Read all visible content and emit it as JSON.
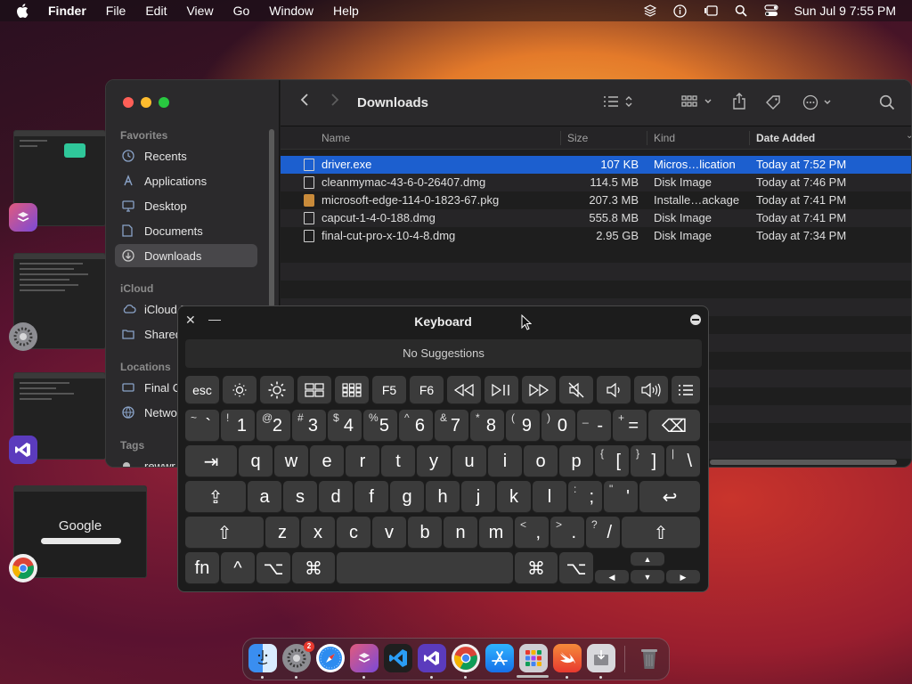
{
  "menubar": {
    "app": "Finder",
    "items": [
      "File",
      "Edit",
      "View",
      "Go",
      "Window",
      "Help"
    ],
    "clock": "Sun Jul 9  7:55 PM"
  },
  "finder": {
    "folder_title": "Downloads",
    "sidebar": {
      "favorites_header": "Favorites",
      "favorites": [
        {
          "label": "Recents",
          "icon": "clock-icon"
        },
        {
          "label": "Applications",
          "icon": "applications-icon"
        },
        {
          "label": "Desktop",
          "icon": "desktop-icon"
        },
        {
          "label": "Documents",
          "icon": "document-icon"
        },
        {
          "label": "Downloads",
          "icon": "download-icon"
        }
      ],
      "icloud_header": "iCloud",
      "icloud": [
        {
          "label": "iCloud D",
          "icon": "cloud-icon"
        },
        {
          "label": "Shared",
          "icon": "shared-folder-icon"
        }
      ],
      "locations_header": "Locations",
      "locations": [
        {
          "label": "Final C",
          "icon": "disk-icon"
        },
        {
          "label": "Netwo",
          "icon": "network-icon"
        }
      ],
      "tags_header": "Tags",
      "tags": [
        {
          "label": "rewwr",
          "icon": "tag-dot-icon"
        }
      ]
    },
    "columns": {
      "name": "Name",
      "size": "Size",
      "kind": "Kind",
      "date": "Date Added"
    },
    "files": [
      {
        "name": "driver.exe",
        "size": "107 KB",
        "kind": "Micros…lication",
        "date": "Today at 7:52 PM",
        "type": "doc"
      },
      {
        "name": "cleanmymac-43-6-0-26407.dmg",
        "size": "114.5 MB",
        "kind": "Disk Image",
        "date": "Today at 7:46 PM",
        "type": "doc"
      },
      {
        "name": "microsoft-edge-114-0-1823-67.pkg",
        "size": "207.3 MB",
        "kind": "Installe…ackage",
        "date": "Today at 7:41 PM",
        "type": "pkg"
      },
      {
        "name": "capcut-1-4-0-188.dmg",
        "size": "555.8 MB",
        "kind": "Disk Image",
        "date": "Today at 7:41 PM",
        "type": "doc"
      },
      {
        "name": "final-cut-pro-x-10-4-8.dmg",
        "size": "2.95 GB",
        "kind": "Disk Image",
        "date": "Today at 7:34 PM",
        "type": "doc"
      }
    ],
    "selected_index": 0
  },
  "keyboard": {
    "title": "Keyboard",
    "suggestions": "No Suggestions",
    "fn_row": [
      "esc",
      "☼",
      "☀",
      "▭",
      "▦",
      "F5",
      "F6",
      "⏪",
      "⏯",
      "⏩",
      "🔇",
      "🔉",
      "🔊",
      "☰"
    ],
    "number_row": [
      {
        "shift": "~",
        "main": "`"
      },
      {
        "shift": "!",
        "main": "1"
      },
      {
        "shift": "@",
        "main": "2"
      },
      {
        "shift": "#",
        "main": "3"
      },
      {
        "shift": "$",
        "main": "4"
      },
      {
        "shift": "%",
        "main": "5"
      },
      {
        "shift": "^",
        "main": "6"
      },
      {
        "shift": "&",
        "main": "7"
      },
      {
        "shift": "*",
        "main": "8"
      },
      {
        "shift": "(",
        "main": "9"
      },
      {
        "shift": ")",
        "main": "0"
      },
      {
        "shift": "_",
        "main": "-"
      },
      {
        "shift": "+",
        "main": "="
      }
    ],
    "delete": "⌫",
    "tab": "⇥",
    "qwerty_row": [
      "q",
      "w",
      "e",
      "r",
      "t",
      "y",
      "u",
      "i",
      "o",
      "p"
    ],
    "qwerty_extra": [
      {
        "shift": "{",
        "main": "["
      },
      {
        "shift": "}",
        "main": "]"
      },
      {
        "shift": "|",
        "main": "\\"
      }
    ],
    "caps": "⇪",
    "home_row": [
      "a",
      "s",
      "d",
      "f",
      "g",
      "h",
      "j",
      "k",
      "l"
    ],
    "home_extra": [
      {
        "shift": ":",
        "main": ";"
      },
      {
        "shift": "\"",
        "main": "'"
      }
    ],
    "return": "↩",
    "shift": "⇧",
    "bottom_letters": [
      "z",
      "x",
      "c",
      "v",
      "b",
      "n",
      "m"
    ],
    "bottom_extra": [
      {
        "shift": "<",
        "main": ","
      },
      {
        "shift": ">",
        "main": "."
      },
      {
        "shift": "?",
        "main": "/"
      }
    ],
    "mods_left": [
      "fn",
      "^",
      "⌥",
      "⌘"
    ],
    "mods_right": [
      "⌘",
      "⌥"
    ],
    "arrows": {
      "up": "▲",
      "left": "◀",
      "down": "▼",
      "right": "▶"
    }
  },
  "dock": {
    "apps": [
      {
        "name": "finder-icon",
        "color": "#3a8ef0"
      },
      {
        "name": "system-settings-icon",
        "color": "#8d8d92",
        "badge": "2"
      },
      {
        "name": "safari-icon",
        "color": "#2d8cf0"
      },
      {
        "name": "shortcuts-icon",
        "color": "#d2429a"
      },
      {
        "name": "vscode-icon",
        "color": "#1f1f1f"
      },
      {
        "name": "visual-studio-icon",
        "color": "#5b3bbd"
      },
      {
        "name": "chrome-icon",
        "color": "#f0f0f0"
      },
      {
        "name": "app-store-icon",
        "color": "#1e8ef5"
      },
      {
        "name": "launchpad-icon",
        "color": "#cfcfd4"
      },
      {
        "name": "swift-icon",
        "color": "#f0703a"
      },
      {
        "name": "installer-icon",
        "color": "#d8d8dc"
      },
      {
        "name": "trash-icon",
        "color": "#6a6a6e"
      }
    ]
  },
  "stage_manager": {
    "thumbs": [
      {
        "name": "stage-window-shortcuts",
        "app_icon": "shortcuts-icon",
        "color": "#d2429a"
      },
      {
        "name": "stage-window-settings",
        "app_icon": "system-settings-icon",
        "color": "#8d8d92"
      },
      {
        "name": "stage-window-visual-studio",
        "app_icon": "visual-studio-icon",
        "color": "#5b3bbd"
      },
      {
        "name": "stage-window-chrome",
        "app_icon": "chrome-icon",
        "color": "#f0f0f0",
        "text": "Google"
      }
    ]
  }
}
